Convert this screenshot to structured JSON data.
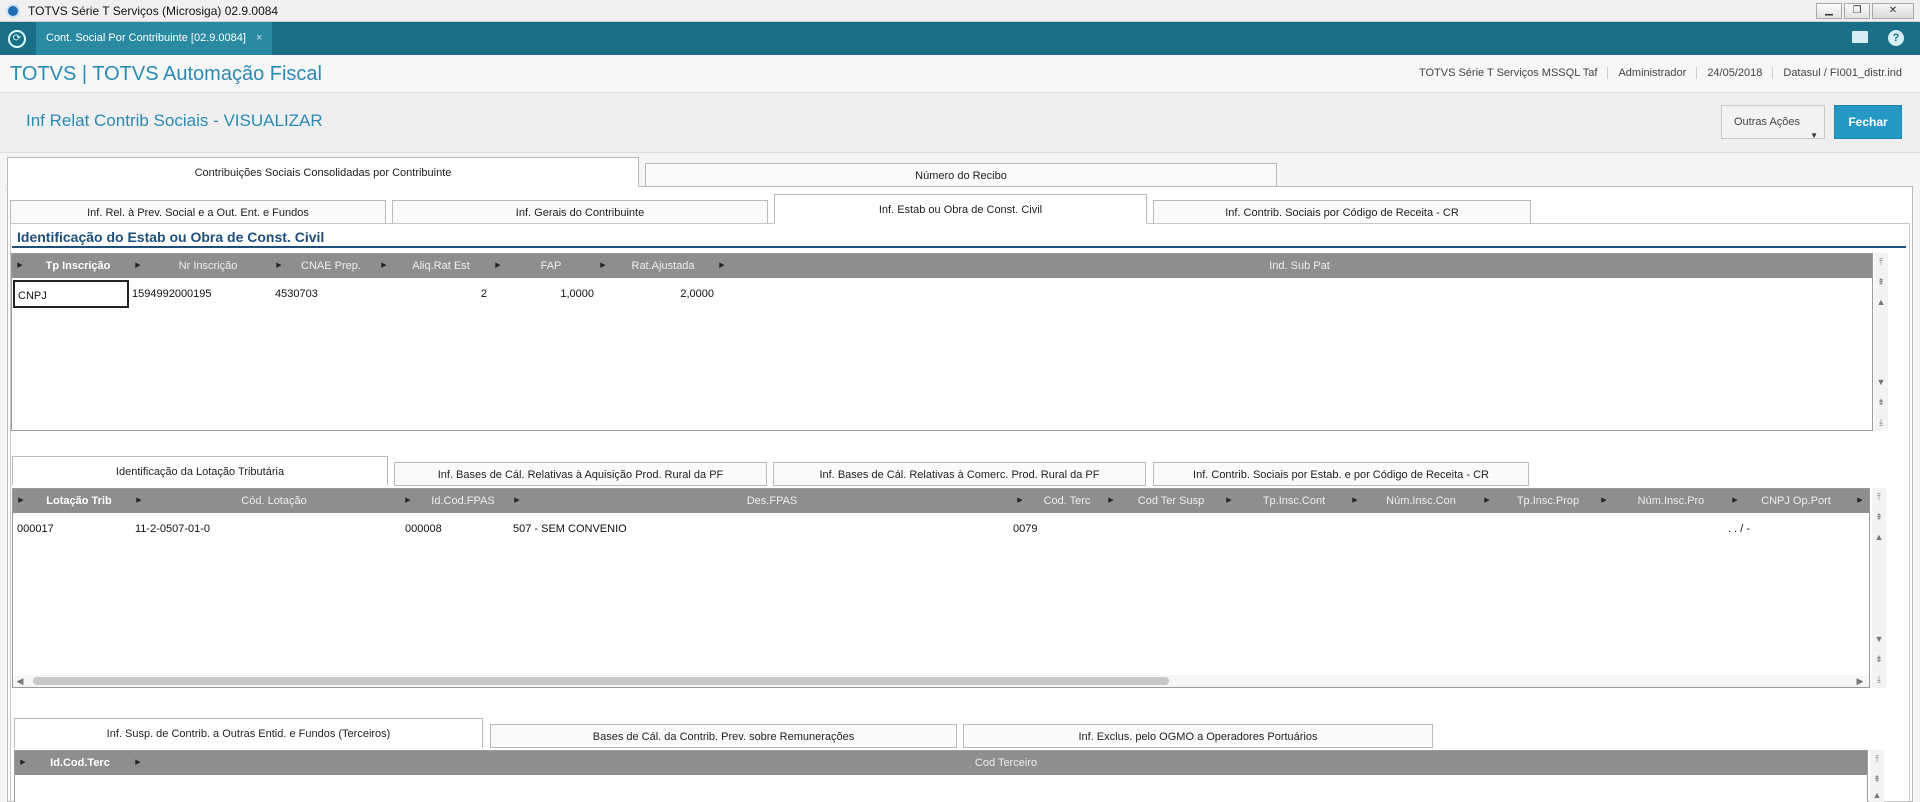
{
  "window": {
    "title": "TOTVS Série T Serviços (Microsiga) 02.9.0084"
  },
  "tabbar": {
    "doc_tab": "Cont. Social Por Contribuinte [02.9.0084]",
    "close": "×"
  },
  "header": {
    "brand": "TOTVS | TOTVS Automação Fiscal",
    "env": "TOTVS Série T Serviços MSSQL Taf",
    "user": "Administrador",
    "date": "24/05/2018",
    "db": "Datasul / FI001_distr.ind"
  },
  "page": {
    "title": "Inf Relat Contrib Sociais - VISUALIZAR",
    "outras_acoes": "Outras Ações",
    "fechar": "Fechar"
  },
  "tabs_top": [
    "Contribuições Sociais Consolidadas por Contribuinte",
    "Número do Recibo"
  ],
  "tabs_level2": [
    "Inf. Rel. à Prev. Social e a Out. Ent. e Fundos",
    "Inf. Gerais do Contribuinte",
    "Inf. Estab ou Obra de Const. Civil",
    "Inf. Contrib. Sociais por Código de Receita - CR"
  ],
  "section_title": "Identificação do Estab ou Obra de Const. Civil",
  "grid1": {
    "columns": [
      "Tp Inscrição",
      "Nr Inscrição",
      "CNAE Prep.",
      "Aliq.Rat Est",
      "FAP",
      "Rat.Ajustada",
      "Ind. Sub Pat"
    ],
    "rows": [
      [
        "CNPJ",
        "1594992000195",
        "4530703",
        "2",
        "1,0000",
        "2,0000",
        ""
      ]
    ]
  },
  "tabs_level3": [
    "Identificação da Lotação Tributária",
    "Inf. Bases de Cál. Relativas à Aquisição Prod. Rural da PF",
    "Inf. Bases de Cál. Relativas à Comerc. Prod. Rural da PF",
    "Inf. Contrib. Sociais por Estab. e por Código de Receita - CR"
  ],
  "grid2": {
    "columns": [
      "Lotação Trib",
      "Cód. Lotação",
      "Id.Cod.FPAS",
      "Des.FPAS",
      "Cod. Terc",
      "Cod Ter Susp",
      "Tp.Insc.Cont",
      "Núm.Insc.Con",
      "Tp.Insc.Prop",
      "Núm.Insc.Pro",
      "CNPJ Op.Port"
    ],
    "rows": [
      [
        "000017",
        "11-2-0507-01-0",
        "000008",
        "507  - SEM CONVENIO",
        "0079",
        "",
        "",
        "",
        "",
        "",
        " .  .  /    -"
      ]
    ]
  },
  "tabs_level4": [
    "Inf. Susp. de Contrib. a Outras Entid. e Fundos (Terceiros)",
    "Bases de Cál. da Contrib. Prev. sobre Remunerações",
    "Inf. Exclus. pelo OGMO a Operadores Portuários"
  ],
  "grid3": {
    "columns": [
      "Id.Cod.Terc",
      "Cod Terceiro"
    ]
  },
  "icons": {
    "app": "totvs-logo-icon",
    "home": "home-icon",
    "mail": "mail-icon",
    "help": "help-icon"
  }
}
